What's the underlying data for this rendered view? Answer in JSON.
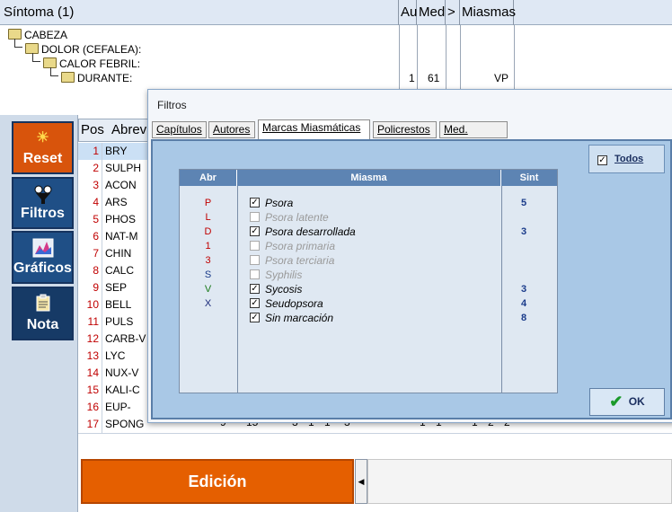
{
  "header": {
    "sintoma": "Síntoma (1)",
    "au": "Au",
    "med": "Med",
    "gt": ">",
    "miasmas": "Miasmas"
  },
  "tree": [
    {
      "label": "CABEZA"
    },
    {
      "label": "DOLOR (CEFALEA):"
    },
    {
      "label": "CALOR FEBRIL:"
    },
    {
      "label": "DURANTE:",
      "au": "1",
      "med": "61",
      "miasma": "VP"
    }
  ],
  "sidebar": {
    "reset": "Reset",
    "filtros": "Filtros",
    "graficos": "Gráficos",
    "nota": "Nota"
  },
  "remedies": {
    "col_pos": "Pos",
    "col_abr": "Abrev",
    "rows": [
      {
        "pos": "1",
        "abr": "BRY"
      },
      {
        "pos": "2",
        "abr": "SULPH"
      },
      {
        "pos": "3",
        "abr": "ACON"
      },
      {
        "pos": "4",
        "abr": "ARS"
      },
      {
        "pos": "5",
        "abr": "PHOS"
      },
      {
        "pos": "6",
        "abr": "NAT-M"
      },
      {
        "pos": "7",
        "abr": "CHIN"
      },
      {
        "pos": "8",
        "abr": "CALC"
      },
      {
        "pos": "9",
        "abr": "SEP"
      },
      {
        "pos": "10",
        "abr": "BELL"
      },
      {
        "pos": "11",
        "abr": "PULS"
      },
      {
        "pos": "12",
        "abr": "CARB-V"
      },
      {
        "pos": "13",
        "abr": "LYC"
      },
      {
        "pos": "14",
        "abr": "NUX-V"
      },
      {
        "pos": "15",
        "abr": "KALI-C"
      },
      {
        "pos": "16",
        "abr": "EUP-PER"
      },
      {
        "pos": "17",
        "abr": "SPONG"
      }
    ],
    "last_row_values": [
      "9",
      "15",
      "3",
      "1",
      "1",
      "3",
      "1",
      "1",
      "1",
      "2",
      "2"
    ]
  },
  "edicion": "Edición",
  "dialog": {
    "title": "Filtros",
    "tabs": [
      "Capítulos",
      "Autores",
      "Marcas Miasmáticas",
      "Policrestos",
      "Med. Chicos"
    ],
    "active_tab": "Marcas Miasmáticas",
    "todos": "Todos",
    "columns": {
      "abr": "Abr",
      "miasma": "Miasma",
      "sint": "Sint"
    },
    "miasmas": [
      {
        "abr": "P",
        "name": "Psora",
        "checked": true,
        "enabled": true,
        "sint": "5",
        "color": "#c00000"
      },
      {
        "abr": "L",
        "name": "Psora latente",
        "checked": false,
        "enabled": false,
        "sint": "",
        "color": "#c00000"
      },
      {
        "abr": "D",
        "name": "Psora desarrollada",
        "checked": true,
        "enabled": true,
        "sint": "3",
        "color": "#c00000"
      },
      {
        "abr": "1",
        "name": "Psora primaria",
        "checked": false,
        "enabled": false,
        "sint": "",
        "color": "#c00000"
      },
      {
        "abr": "3",
        "name": "Psora terciaria",
        "checked": false,
        "enabled": false,
        "sint": "",
        "color": "#c00000"
      },
      {
        "abr": "S",
        "name": "Syphilis",
        "checked": false,
        "enabled": false,
        "sint": "",
        "color": "#1a3b8a"
      },
      {
        "abr": "V",
        "name": "Sycosis",
        "checked": true,
        "enabled": true,
        "sint": "3",
        "color": "#1a7a1a"
      },
      {
        "abr": "X",
        "name": "Seudopsora",
        "checked": true,
        "enabled": true,
        "sint": "4",
        "color": "#1a2a7a"
      },
      {
        "abr": "",
        "name": "Sin marcación",
        "checked": true,
        "enabled": true,
        "sint": "8",
        "color": "#000000"
      }
    ],
    "ok": "OK"
  },
  "colors": {
    "edit_orange": "#e55f00",
    "reset_orange": "#d8540c",
    "nav_blue": "#1f4f86",
    "dialog_panel": "#a9c8e6"
  }
}
